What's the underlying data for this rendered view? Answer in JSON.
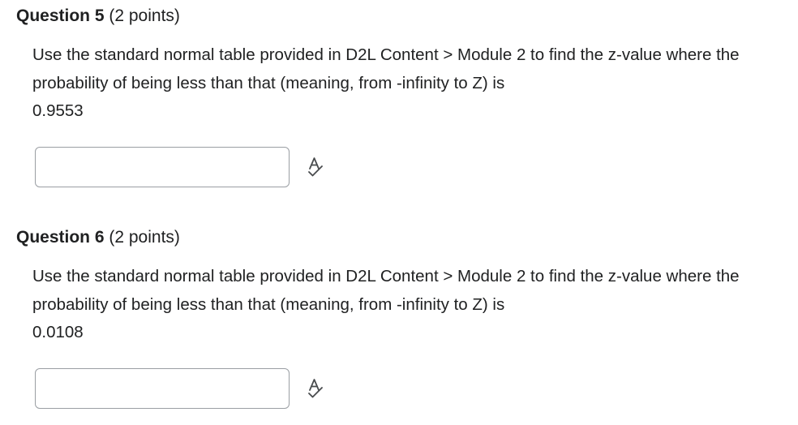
{
  "questions": [
    {
      "title": "Question 5",
      "points": "(2 points)",
      "prompt": "Use the standard normal table provided in D2L Content > Module 2 to find the z-value where the probability of being less than that (meaning, from -infinity to Z) is",
      "value": "0.9553",
      "answer": {
        "value": "",
        "placeholder": ""
      },
      "tool_icon": "spell-check-icon"
    },
    {
      "title": "Question 6",
      "points": "(2 points)",
      "prompt": "Use the standard normal table provided in D2L Content > Module 2 to find the z-value where the probability of being less than that (meaning, from -infinity to Z) is",
      "value": "0.0108",
      "answer": {
        "value": "",
        "placeholder": ""
      },
      "tool_icon": "spell-check-icon"
    }
  ],
  "colors": {
    "text": "#202122",
    "input_border": "#9a9ea3",
    "icon": "#494c4e"
  }
}
